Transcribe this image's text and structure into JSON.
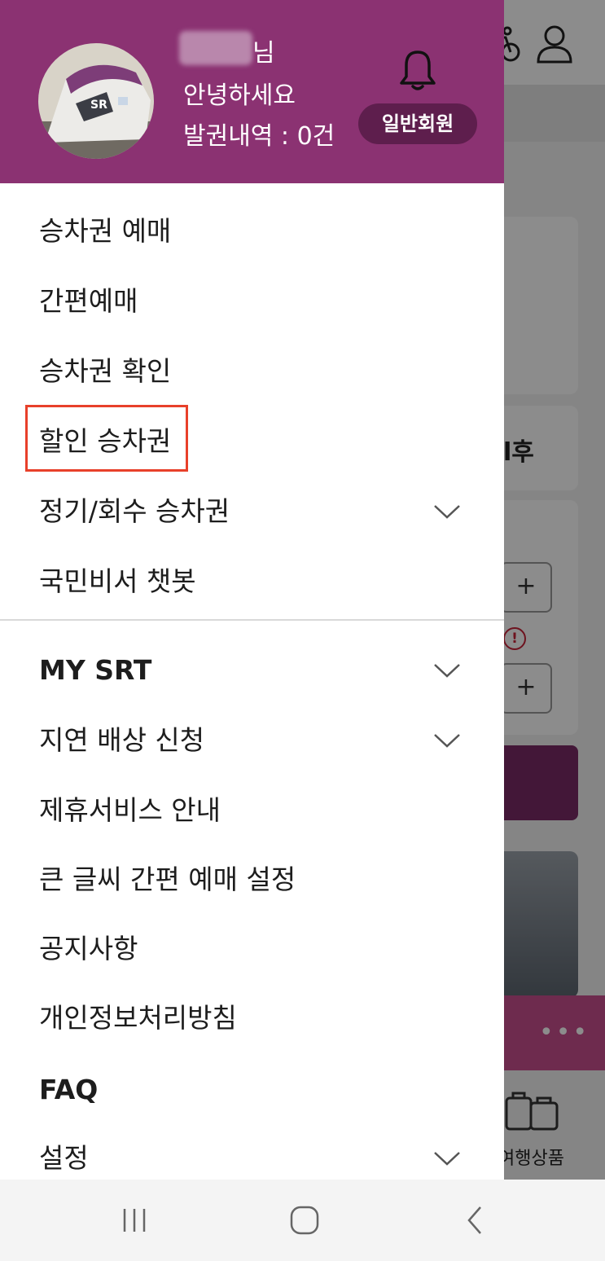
{
  "background": {
    "partial_card_text": "l후",
    "stepper_plus": "+",
    "alert_mark": "!",
    "more_dots": "•••",
    "bottom_label": "여행상품"
  },
  "drawer": {
    "header": {
      "name_suffix": "님",
      "greeting": "안녕하세요",
      "issued_history": "발권내역 : 0건",
      "member_badge": "일반회원",
      "avatar_logo": "SR"
    },
    "menu_group1": [
      {
        "label": "승차권 예매"
      },
      {
        "label": "간편예매"
      },
      {
        "label": "승차권 확인"
      },
      {
        "label": "할인 승차권",
        "highlighted": true
      },
      {
        "label": "정기/회수 승차권",
        "expandable": true
      },
      {
        "label": "국민비서 챗봇"
      }
    ],
    "menu_group2": [
      {
        "label": "MY SRT",
        "expandable": true
      },
      {
        "label": "지연 배상 신청",
        "expandable": true
      },
      {
        "label": "제휴서비스 안내"
      },
      {
        "label": "큰 글씨 간편 예매 설정"
      },
      {
        "label": "공지사항"
      },
      {
        "label": "개인정보처리방침"
      },
      {
        "label": "FAQ"
      },
      {
        "label": "설정",
        "expandable": true
      }
    ]
  },
  "colors": {
    "brand": "#8b3272",
    "badge": "#5e1e4d",
    "highlight_box": "#e8402a"
  },
  "icons": {
    "bell": "bell-icon",
    "chevron": "chevron-down-icon",
    "nav_recents": "recent-apps-icon",
    "nav_home": "home-icon",
    "nav_back": "back-icon"
  }
}
